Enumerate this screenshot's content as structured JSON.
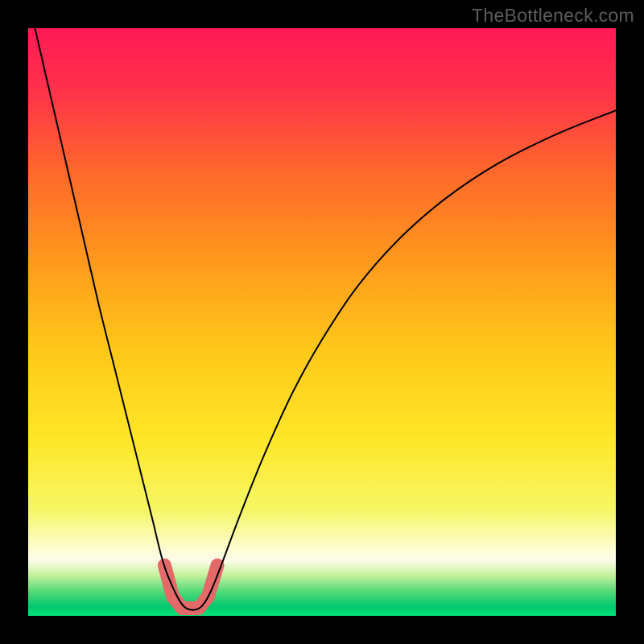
{
  "watermark": "TheBottleneck.com",
  "chart_data": {
    "type": "line",
    "title": "",
    "xlabel": "",
    "ylabel": "",
    "xlim": [
      0,
      100
    ],
    "ylim": [
      0,
      100
    ],
    "series": [
      {
        "name": "curve",
        "x": [
          0,
          3,
          6,
          9,
          12,
          15,
          18,
          21,
          23,
          25,
          26.5,
          28,
          29.5,
          31,
          33,
          36,
          40,
          45,
          50,
          56,
          63,
          71,
          80,
          90,
          100
        ],
        "y": [
          105,
          92,
          79,
          66,
          53,
          41,
          29,
          17,
          9,
          4,
          1.6,
          1.0,
          1.6,
          4,
          9,
          17,
          27,
          38,
          47,
          56,
          64,
          71,
          77,
          82,
          86
        ]
      }
    ],
    "highlight_segments": [
      {
        "x": [
          23.2,
          24.6
        ],
        "y": [
          8.6,
          3.3
        ]
      },
      {
        "x": [
          24.6,
          26.2
        ],
        "y": [
          3.3,
          1.3
        ]
      },
      {
        "x": [
          26.2,
          29.0
        ],
        "y": [
          1.3,
          1.3
        ]
      },
      {
        "x": [
          29.0,
          30.6
        ],
        "y": [
          1.3,
          3.3
        ]
      },
      {
        "x": [
          30.6,
          32.2
        ],
        "y": [
          3.3,
          8.6
        ]
      }
    ],
    "gradient_stops": [
      {
        "offset": 0.0,
        "color": "#ff1a55"
      },
      {
        "offset": 0.1,
        "color": "#ff2f4b"
      },
      {
        "offset": 0.25,
        "color": "#ff6a2a"
      },
      {
        "offset": 0.4,
        "color": "#ff9a1c"
      },
      {
        "offset": 0.55,
        "color": "#ffc91a"
      },
      {
        "offset": 0.7,
        "color": "#ffe627"
      },
      {
        "offset": 0.82,
        "color": "#f6f765"
      },
      {
        "offset": 0.885,
        "color": "#fdfccf"
      },
      {
        "offset": 0.905,
        "color": "#fdfce8"
      },
      {
        "offset": 0.93,
        "color": "#c8f2a0"
      },
      {
        "offset": 0.958,
        "color": "#56d977"
      },
      {
        "offset": 0.985,
        "color": "#00c86e"
      },
      {
        "offset": 1.0,
        "color": "#00e57a"
      }
    ]
  }
}
